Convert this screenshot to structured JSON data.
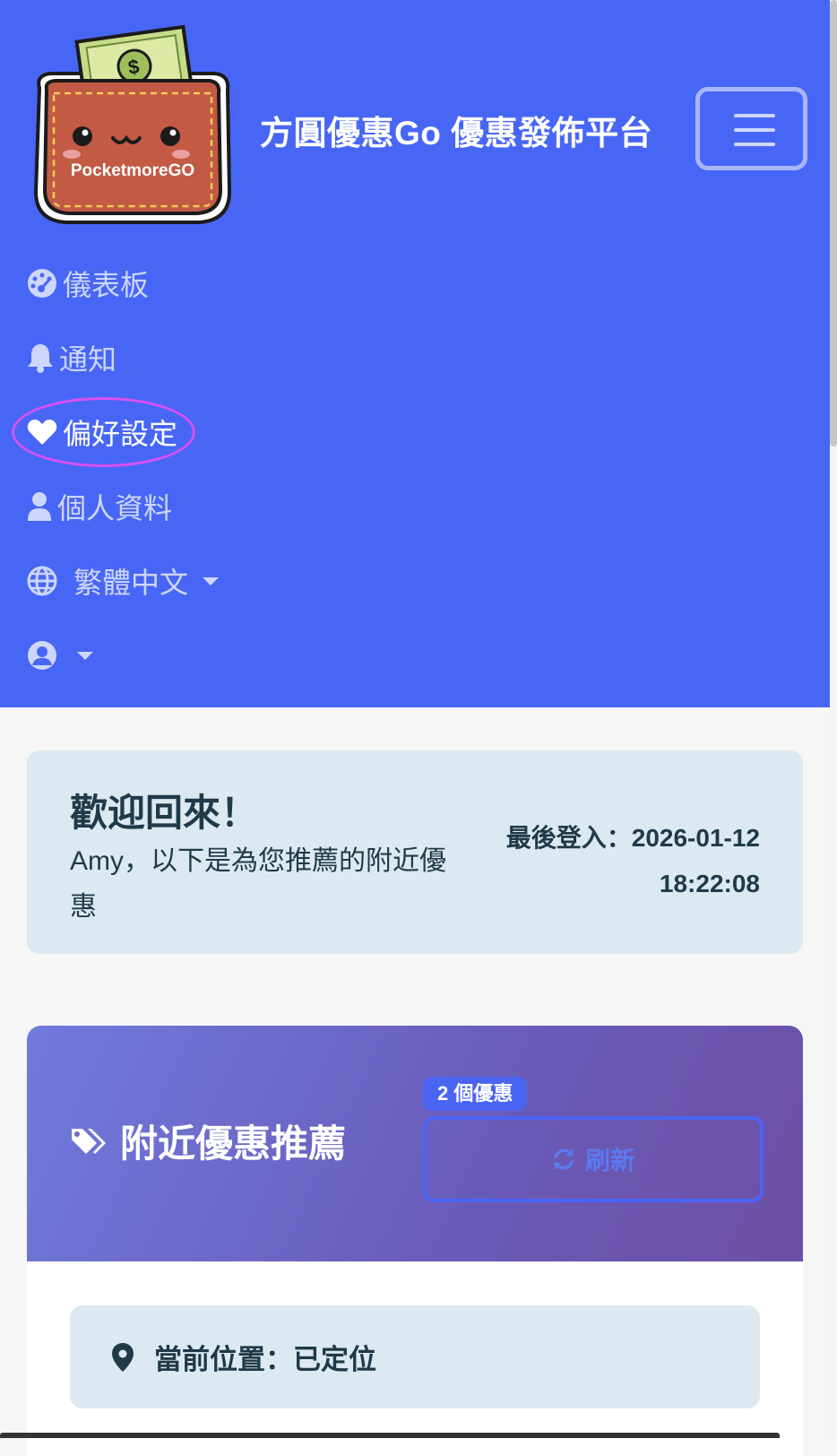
{
  "navbar": {
    "logo_text": "PocketmoreGO",
    "brand": "方圓優惠Go 優惠發佈平台",
    "items": [
      {
        "label": "儀表板",
        "icon": "dashboard-icon"
      },
      {
        "label": "通知",
        "icon": "bell-icon"
      },
      {
        "label": "偏好設定",
        "icon": "heart-icon"
      },
      {
        "label": "個人資料",
        "icon": "user-icon"
      },
      {
        "label": "繁體中文",
        "icon": "globe-icon"
      }
    ],
    "user_menu_icon": "user-circle-icon"
  },
  "welcome": {
    "title": "歡迎回來！",
    "subtitle": "Amy，以下是為您推薦的附近優惠",
    "last_login": "最後登入：2026-01-12 18:22:08"
  },
  "deals": {
    "title": "附近優惠推薦",
    "title_icon": "tags-icon",
    "count_badge": "2 個優惠",
    "refresh_label": "刷新",
    "refresh_icon": "refresh-icon",
    "location_label": "當前位置：已定位",
    "location_icon": "map-pin-icon"
  },
  "colors": {
    "navbar_bg": "#4866f5",
    "accent": "#4a64f2",
    "highlight_ring": "#d850f0",
    "header_gradient_start": "#6f7bdc",
    "header_gradient_end": "#6c4fa5",
    "info_bg": "#dce9f0"
  }
}
